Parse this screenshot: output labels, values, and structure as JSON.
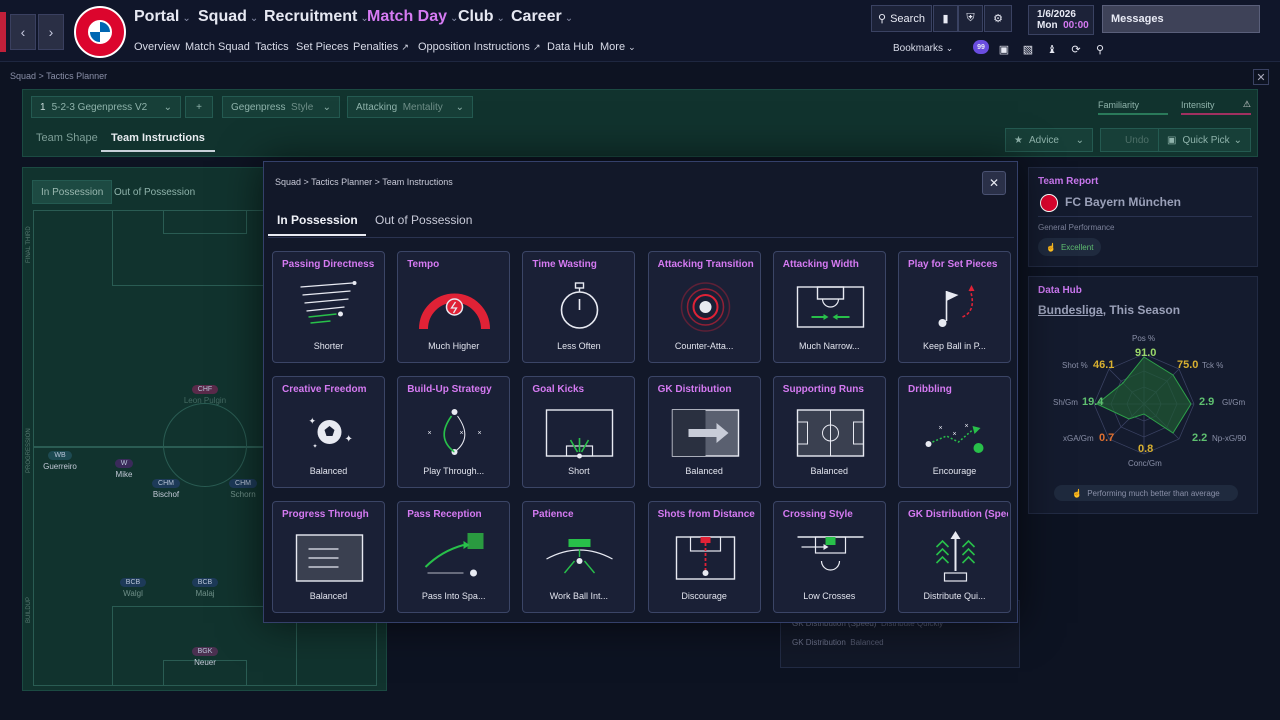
{
  "topbar": {
    "nav": [
      "Portal",
      "Squad",
      "Recruitment",
      "Match Day",
      "Club",
      "Career"
    ],
    "active_nav": "Match Day",
    "subnav": [
      "Overview",
      "Match Squad",
      "Tactics",
      "Set Pieces",
      "Penalties",
      "Opposition Instructions",
      "Data Hub",
      "More"
    ],
    "search_label": "Search",
    "date": "1/6/2026",
    "day": "Mon",
    "time": "00:00",
    "messages_label": "Messages",
    "bookmarks_label": "Bookmarks",
    "club_badge_text": "FC BAYERN MÜNCHEN",
    "notif_badge": "99"
  },
  "breadcrumb_main": [
    "Squad",
    "Tactics Planner"
  ],
  "tactics": {
    "slot": "1",
    "formation": "5-2-3 Gegenpress V2",
    "add_label": "+",
    "style_value": "Gegenpress",
    "style_label": "Style",
    "mentality_value": "Attacking",
    "mentality_label": "Mentality",
    "familiarity_label": "Familiarity",
    "intensity_label": "Intensity",
    "tabs": [
      "Team Shape",
      "Team Instructions"
    ],
    "active_tab": "Team Instructions",
    "advice_label": "Advice",
    "undo_label": "Undo",
    "quick_pick_label": "Quick Pick"
  },
  "pitch": {
    "tabs": [
      "In Possession",
      "Out of Possession"
    ],
    "zones": [
      "FINAL THIRD",
      "PROGRESSION",
      "BUILDUP"
    ],
    "players": [
      {
        "pos": "CHF",
        "name": "Leon Pulgin"
      },
      {
        "pos": "WB",
        "name": "Guerreiro"
      },
      {
        "pos": "W",
        "name": "Mike"
      },
      {
        "pos": "CHM",
        "name": "Bischof"
      },
      {
        "pos": "CHM",
        "name": "Schorn"
      },
      {
        "pos": "BCB",
        "name": "Walgl"
      },
      {
        "pos": "BCB",
        "name": "Malaj"
      },
      {
        "pos": "BGK",
        "name": "Neuer"
      }
    ]
  },
  "team_report": {
    "title": "Team Report",
    "club": "FC Bayern München",
    "perf_label": "General Performance",
    "perf_value": "Excellent"
  },
  "data_hub": {
    "title": "Data Hub",
    "league": "Bundesliga",
    "season": ", This Season",
    "stats": [
      {
        "label": "Pos %",
        "value": "91.0"
      },
      {
        "label": "Tck %",
        "value": "75.0"
      },
      {
        "label": "Gl/Gm",
        "value": "2.9"
      },
      {
        "label": "Np-xG/90",
        "value": "2.2"
      },
      {
        "label": "Conc/Gm",
        "value": "0.8"
      },
      {
        "label": "xGA/Gm",
        "value": "0.7"
      },
      {
        "label": "Sh/Gm",
        "value": "19.4"
      },
      {
        "label": "Shot %",
        "value": "46.1"
      }
    ],
    "summary": "Performing much better than average"
  },
  "behind_list": [
    {
      "label": "GK Distribution (Speed)",
      "value": "Distribute Quickly"
    },
    {
      "label": "GK Distribution",
      "value": "Balanced"
    }
  ],
  "modal": {
    "breadcrumb": [
      "Squad",
      "Tactics Planner",
      "Team Instructions"
    ],
    "tabs": [
      "In Possession",
      "Out of Possession"
    ],
    "active_tab": "In Possession",
    "cards": [
      {
        "title": "Passing Directness",
        "value": "Shorter",
        "icon": "passing-directness-icon"
      },
      {
        "title": "Tempo",
        "value": "Much Higher",
        "icon": "tempo-gauge-icon"
      },
      {
        "title": "Time Wasting",
        "value": "Less Often",
        "icon": "stopwatch-icon"
      },
      {
        "title": "Attacking Transition",
        "value": "Counter-Atta...",
        "icon": "transition-target-icon"
      },
      {
        "title": "Attacking Width",
        "value": "Much Narrow...",
        "icon": "attacking-width-icon"
      },
      {
        "title": "Play for Set Pieces",
        "value": "Keep Ball in P...",
        "icon": "set-piece-flag-icon"
      },
      {
        "title": "Creative Freedom",
        "value": "Balanced",
        "icon": "creative-ball-icon"
      },
      {
        "title": "Build-Up Strategy",
        "value": "Play Through...",
        "icon": "build-up-icon"
      },
      {
        "title": "Goal Kicks",
        "value": "Short",
        "icon": "goal-kick-icon"
      },
      {
        "title": "GK Distribution",
        "value": "Balanced",
        "icon": "gk-distribution-icon"
      },
      {
        "title": "Supporting Runs",
        "value": "Balanced",
        "icon": "supporting-runs-icon"
      },
      {
        "title": "Dribbling",
        "value": "Encourage",
        "icon": "dribbling-icon"
      },
      {
        "title": "Progress Through",
        "value": "Balanced",
        "icon": "progress-through-icon"
      },
      {
        "title": "Pass Reception",
        "value": "Pass Into Spa...",
        "icon": "pass-reception-icon"
      },
      {
        "title": "Patience",
        "value": "Work Ball Int...",
        "icon": "patience-icon"
      },
      {
        "title": "Shots from Distance",
        "value": "Discourage",
        "icon": "shots-distance-icon"
      },
      {
        "title": "Crossing Style",
        "value": "Low Crosses",
        "icon": "crossing-style-icon"
      },
      {
        "title": "GK Distribution (Speed",
        "value": "Distribute Qui...",
        "icon": "gk-speed-icon"
      }
    ]
  },
  "colors": {
    "accent": "#d57af2",
    "green": "#28c04a",
    "red": "#e02236",
    "bg": "#0d1322"
  }
}
